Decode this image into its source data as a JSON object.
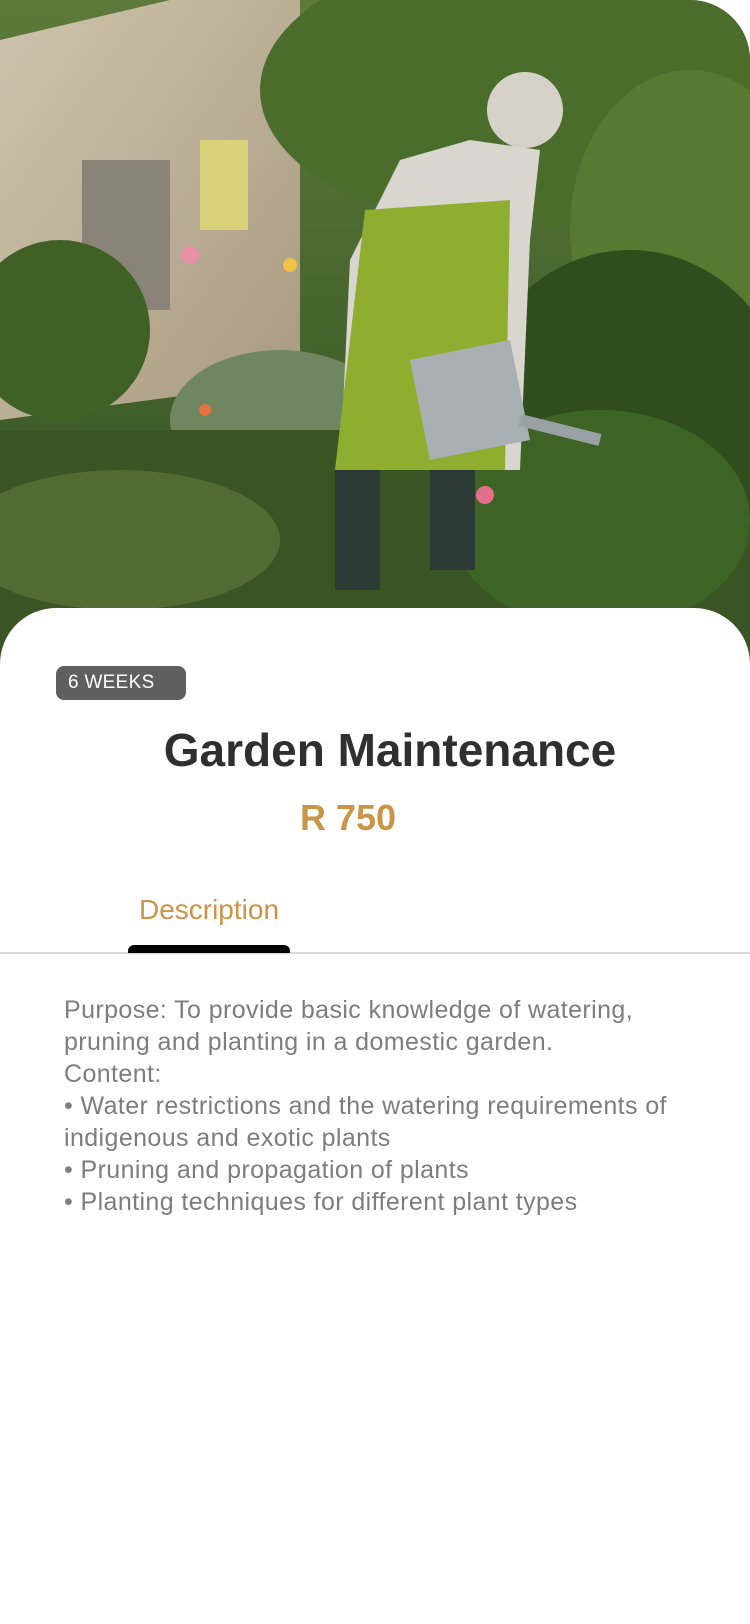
{
  "hero": {
    "image": "woman-watering-garden-photo"
  },
  "course": {
    "duration_badge": "6 WEEKS",
    "title": "Garden Maintenance",
    "price": "R 750"
  },
  "tabs": [
    {
      "label": "Description",
      "active": true
    }
  ],
  "description": {
    "purpose": "Purpose: To provide basic knowledge of watering, pruning and planting in a domestic garden.",
    "content_heading": "Content:",
    "bullets": [
      "• Water restrictions and the watering requirements of indigenous and exotic plants",
      "• Pruning and propagation of plants",
      "• Planting techniques for different plant types"
    ]
  },
  "colors": {
    "accent": "#c99548",
    "title": "#2f2f2f",
    "body_text": "#7d7d7d",
    "badge_bg": "#5f5f5f",
    "tab_indicator": "#000000"
  }
}
